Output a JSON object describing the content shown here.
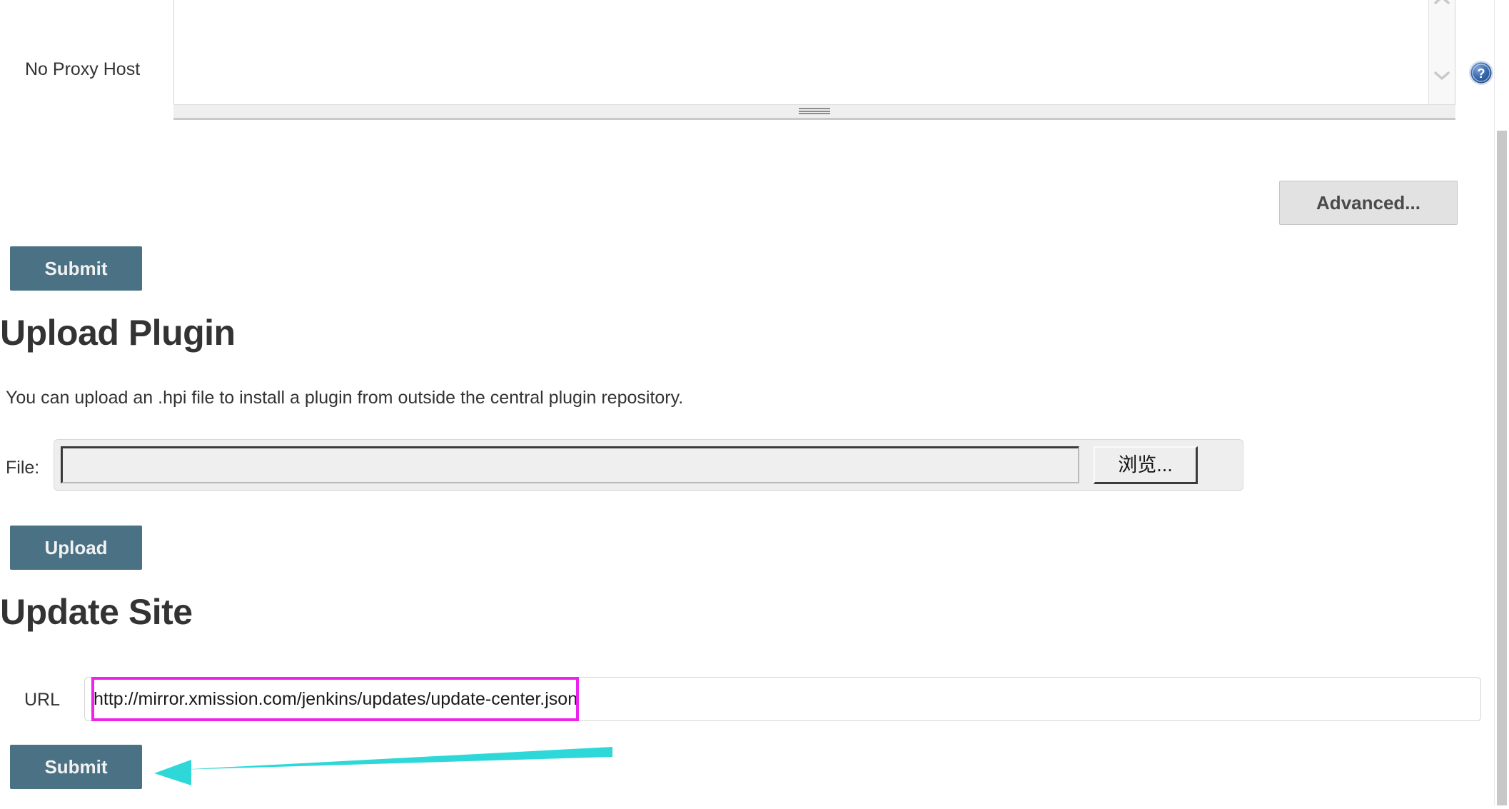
{
  "proxy": {
    "no_proxy_host_label": "No Proxy Host",
    "no_proxy_host_value": "",
    "no_proxy_host_placeholder": "",
    "help_icon": "help-question-icon",
    "scroll_up_icon": "chevron-up-icon",
    "scroll_down_icon": "chevron-down-icon",
    "resize_grip": "resize-grip-icon",
    "advanced_button": "Advanced...",
    "submit_button": "Submit"
  },
  "upload_plugin": {
    "heading": "Upload Plugin",
    "description": "You can upload an .hpi file to install a plugin from outside the central plugin repository.",
    "file_label": "File:",
    "file_value": "",
    "file_placeholder": "",
    "browse_button": "浏览...",
    "upload_button": "Upload"
  },
  "update_site": {
    "heading": "Update Site",
    "url_label": "URL",
    "url_value": "http://mirror.xmission.com/jenkins/updates/update-center.json",
    "url_placeholder": "",
    "submit_button": "Submit"
  },
  "annotations": {
    "highlight_box_color": "#ee22ee",
    "arrow_color": "#2fd8d8",
    "highlight_target": "url-input",
    "arrow_target": "update-site-submit-button"
  },
  "colors": {
    "primary_button_bg": "#4a7284",
    "primary_button_text": "#f2f2f2",
    "secondary_button_bg": "#e2e2e2",
    "heading_text": "#333333",
    "page_background": "#ffffff",
    "help_icon_blue": "#2b5fa8"
  }
}
